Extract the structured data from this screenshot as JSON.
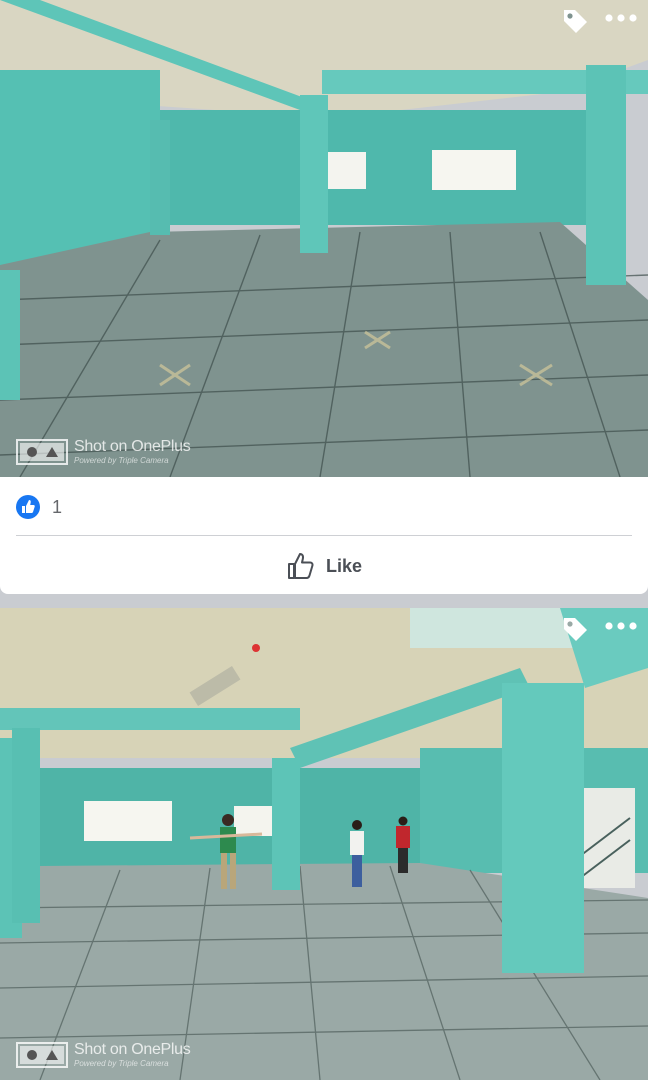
{
  "photos": [
    {
      "watermark_title": "Shot on OnePlus",
      "watermark_subtitle": "Powered by Triple Camera",
      "icons": [
        "tag-icon",
        "more-options-icon",
        "oneplus-camera-icon"
      ]
    },
    {
      "watermark_title": "Shot on OnePlus",
      "watermark_subtitle": "Powered by Triple Camera",
      "icons": [
        "tag-icon",
        "more-options-icon",
        "oneplus-camera-icon"
      ]
    }
  ],
  "reactions": {
    "count": "1",
    "icon": "like-reaction-icon",
    "color": "#1877f2"
  },
  "actions": {
    "like_label": "Like",
    "like_icon": "thumbs-up-icon"
  }
}
